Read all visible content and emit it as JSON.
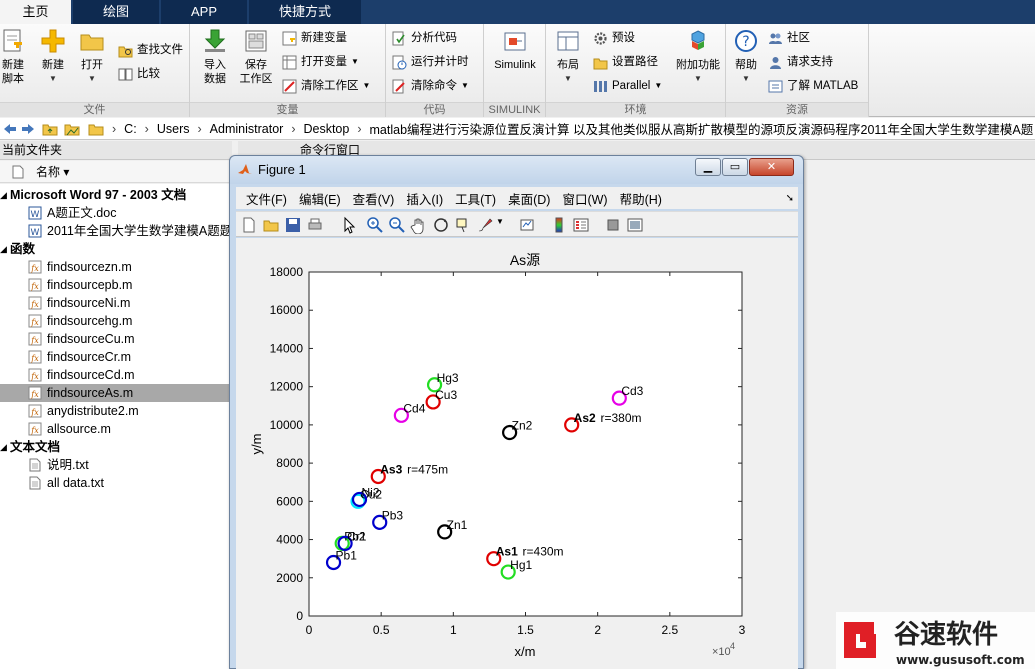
{
  "tabs": [
    "主页",
    "绘图",
    "APP",
    "快捷方式"
  ],
  "ribbon": {
    "file": {
      "new_script": "新建\n脚本",
      "new": "新建",
      "open": "打开",
      "find_files": "查找文件",
      "compare": "比较",
      "label": "文件"
    },
    "variable": {
      "import_data": "导入\n数据",
      "save_workspace": "保存\n工作区",
      "new_variable": "新建变量",
      "open_variable": "打开变量",
      "clear_workspace": "清除工作区",
      "label": "变量"
    },
    "code": {
      "analyze": "分析代码",
      "run_time": "运行并计时",
      "clear_commands": "清除命令",
      "label": "代码"
    },
    "simulink": {
      "simulink": "Simulink",
      "label": "SIMULINK"
    },
    "environment": {
      "layout": "布局",
      "preferences": "预设",
      "set_path": "设置路径",
      "parallel": "Parallel",
      "addons": "附加功能",
      "label": "环境"
    },
    "resources": {
      "help": "帮助",
      "community": "社区",
      "request_support": "请求支持",
      "learn_matlab": "了解 MATLAB",
      "label": "资源"
    }
  },
  "address": {
    "crumbs": [
      "C:",
      "Users",
      "Administrator",
      "Desktop",
      "matlab编程进行污染源位置反演计算 以及其他类似服从高斯扩散模型的源项反演源码程序2011年全国大学生数学建模A题"
    ]
  },
  "panels": {
    "current_folder": "当前文件夹",
    "command_window": "命令行窗口",
    "name_column": "名称 ▾"
  },
  "files": {
    "groups": [
      {
        "title": "Microsoft Word 97 - 2003 文档",
        "items": [
          "A题正文.doc",
          "2011年全国大学生数学建模A题题"
        ]
      },
      {
        "title": "函数",
        "items": [
          "findsourcezn.m",
          "findsourcepb.m",
          "findsourceNi.m",
          "findsourcehg.m",
          "findsourceCu.m",
          "findsourceCr.m",
          "findsourceCd.m",
          "findsourceAs.m",
          "anydistribute2.m",
          "allsource.m"
        ]
      },
      {
        "title": "文本文档",
        "items": [
          "说明.txt",
          "all data.txt"
        ]
      }
    ],
    "selected": "findsourceAs.m"
  },
  "figure": {
    "title": "Figure 1",
    "menu": [
      "文件(F)",
      "编辑(E)",
      "查看(V)",
      "插入(I)",
      "工具(T)",
      "桌面(D)",
      "窗口(W)",
      "帮助(H)"
    ]
  },
  "chart_data": {
    "type": "scatter",
    "title": "As源",
    "xlabel": "x/m",
    "ylabel": "y/m",
    "x_exponent_label": "×10",
    "x_exponent_power": "4",
    "xlim": [
      0,
      30000
    ],
    "ylim": [
      0,
      18000
    ],
    "x_ticks": [
      0,
      5000,
      10000,
      15000,
      20000,
      25000,
      30000
    ],
    "x_tick_labels": [
      "0",
      "0.5",
      "1",
      "1.5",
      "2",
      "2.5",
      "3"
    ],
    "y_ticks": [
      0,
      2000,
      4000,
      6000,
      8000,
      10000,
      12000,
      14000,
      16000,
      18000
    ],
    "y_tick_labels": [
      "0",
      "2000",
      "4000",
      "6000",
      "8000",
      "10000",
      "12000",
      "14000",
      "16000",
      "18000"
    ],
    "grid": false,
    "points": [
      {
        "x": 4800,
        "y": 7300,
        "label": "As3",
        "note": "r=475m",
        "color": "#e00000",
        "bold": true
      },
      {
        "x": 18200,
        "y": 10000,
        "label": "As2",
        "note": "r=380m",
        "color": "#e00000",
        "bold": true
      },
      {
        "x": 12800,
        "y": 3000,
        "label": "As1",
        "note": "r=430m",
        "color": "#e00000",
        "bold": true
      },
      {
        "x": 8700,
        "y": 12100,
        "label": "Hg3",
        "note": "",
        "color": "#22dd22",
        "bold": false
      },
      {
        "x": 13800,
        "y": 2300,
        "label": "Hg1",
        "note": "",
        "color": "#22dd22",
        "bold": false
      },
      {
        "x": 8600,
        "y": 11200,
        "label": "Cu3",
        "note": "",
        "color": "#e00000",
        "bold": false
      },
      {
        "x": 3400,
        "y": 6000,
        "label": "Cu2",
        "note": "",
        "color": "#00e5ff",
        "bold": false
      },
      {
        "x": 2300,
        "y": 3800,
        "label": "Pb2",
        "note": "",
        "color": "#22dd22",
        "bold": false
      },
      {
        "x": 6400,
        "y": 10500,
        "label": "Cd4",
        "note": "",
        "color": "#e600e6",
        "bold": false
      },
      {
        "x": 21500,
        "y": 11400,
        "label": "Cd3",
        "note": "",
        "color": "#e600e6",
        "bold": false
      },
      {
        "x": 13900,
        "y": 9600,
        "label": "Zn2",
        "note": "",
        "color": "#000000",
        "bold": false
      },
      {
        "x": 9400,
        "y": 4400,
        "label": "Zn1",
        "note": "",
        "color": "#000000",
        "bold": false
      },
      {
        "x": 4900,
        "y": 4900,
        "label": "Pb3",
        "note": "",
        "color": "#0000cc",
        "bold": false
      },
      {
        "x": 1700,
        "y": 2800,
        "label": "Pb1",
        "note": "",
        "color": "#0000cc",
        "bold": false
      },
      {
        "x": 3500,
        "y": 6100,
        "label": "Ni2",
        "note": "",
        "color": "#0000cc",
        "bold": false
      },
      {
        "x": 2500,
        "y": 3800,
        "label": "Cr1",
        "note": "",
        "color": "#0000cc",
        "bold": false
      }
    ]
  },
  "watermark": {
    "brand": "谷速软件",
    "url": "www.gususoft.com",
    "brand_color": "#e01f26"
  }
}
